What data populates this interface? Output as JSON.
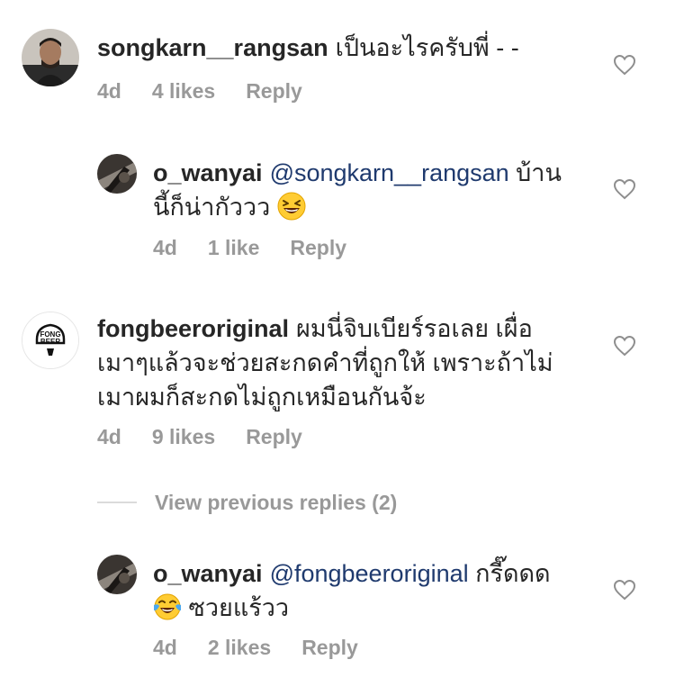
{
  "comments": [
    {
      "username": "songkarn__rangsan",
      "text": "เป็นอะไรครับพี่ - -",
      "time": "4d",
      "likes": "4 likes",
      "reply": "Reply",
      "avatar": "person-photo"
    },
    {
      "username": "o_wanyai",
      "mention": "@songkarn__rangsan",
      "text_line1": "บ้าน",
      "text_line2": "นี้ก็น่ากัววว",
      "emoji": "grinning-squinting-face",
      "time": "4d",
      "likes": "1 like",
      "reply": "Reply",
      "avatar": "dark-photo"
    },
    {
      "username": "fongbeeroriginal",
      "text_line1": "ผมนี่จิบเบียร์รอเลย เผื่อ",
      "text_line2": "เมาๆแล้วจะช่วยสะกดคำที่ถูกให้ เพราะถ้าไม่",
      "text_line3": "เมาผมก็สะกดไม่ถูกเหมือนกันจ้ะ",
      "time": "4d",
      "likes": "9 likes",
      "reply": "Reply",
      "avatar": "fong-beer-logo",
      "avatar_text_1": "FONG",
      "avatar_text_2": "BEER"
    },
    {
      "username": "o_wanyai",
      "mention": "@fongbeeroriginal",
      "text_line1": "กรี๊ดดด",
      "text_line2": "ซวยแร้วว",
      "emoji": "face-with-tears-of-joy",
      "time": "4d",
      "likes": "2 likes",
      "reply": "Reply",
      "avatar": "dark-photo"
    }
  ],
  "view_previous_replies": "View previous replies (2)",
  "colors": {
    "text": "#262626",
    "meta": "#999999",
    "mention": "#1f3a6e",
    "divider": "#dbdbdb"
  },
  "icons": {
    "like": "heart-outline-icon"
  }
}
